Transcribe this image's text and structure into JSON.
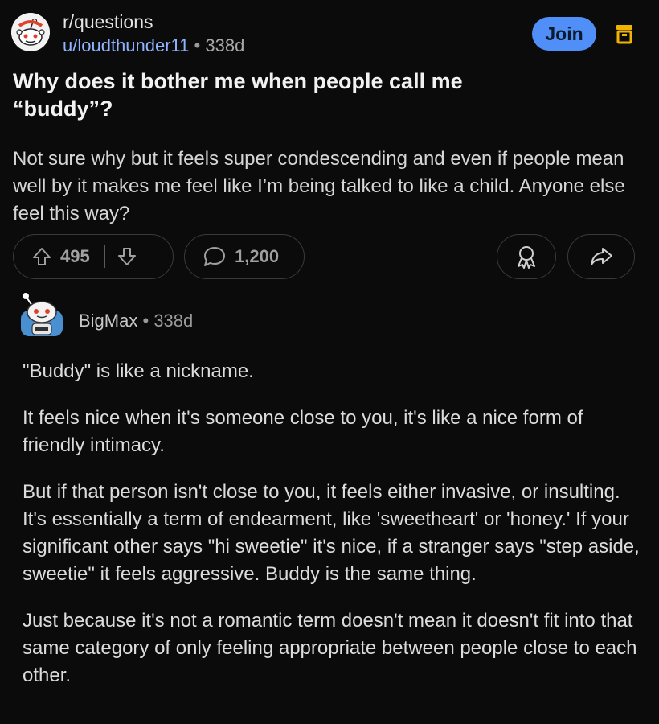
{
  "post": {
    "subreddit": "r/questions",
    "author": "u/loudthunder11",
    "separator": "•",
    "age": "338d",
    "join_label": "Join",
    "title_line1": "Why does it bother me when people call me",
    "title_line2": "“buddy”?",
    "body": "Not sure why but it feels super condescending and even if people mean well by it makes me feel like I’m being talked to like a child. Anyone else feel this way?",
    "upvotes": "495",
    "comments": "1,200",
    "icons": {
      "subreddit": "reddit-snoo-icon",
      "menu": "archive-icon",
      "upvote": "arrow-up-icon",
      "downvote": "arrow-down-icon",
      "comment": "comment-bubble-icon",
      "award": "award-icon",
      "share": "share-icon"
    }
  },
  "comment": {
    "author": "BigMax",
    "separator": "•",
    "age": "338d",
    "avatar_icon": "snoo-avatar-icon",
    "paragraphs": [
      "\"Buddy\" is like a nickname.",
      "It feels nice when it's someone close to you, it's like a nice form of friendly intimacy.",
      "But if that person isn't close to you, it feels either invasive, or insulting.  It's essentially a term of endearment, like 'sweetheart' or 'honey.'  If your significant other says \"hi sweetie\" it's nice, if a stranger says \"step aside, sweetie\" it feels aggressive.  Buddy is the same thing.",
      "Just because it's not a romantic term doesn't mean it doesn't fit into that same category of only feeling appropriate between people close to each other."
    ]
  },
  "colors": {
    "background": "#0b0b0c",
    "accent": "#4f8ff7",
    "username": "#8fb3ff",
    "menu_icon": "#f0b400"
  }
}
